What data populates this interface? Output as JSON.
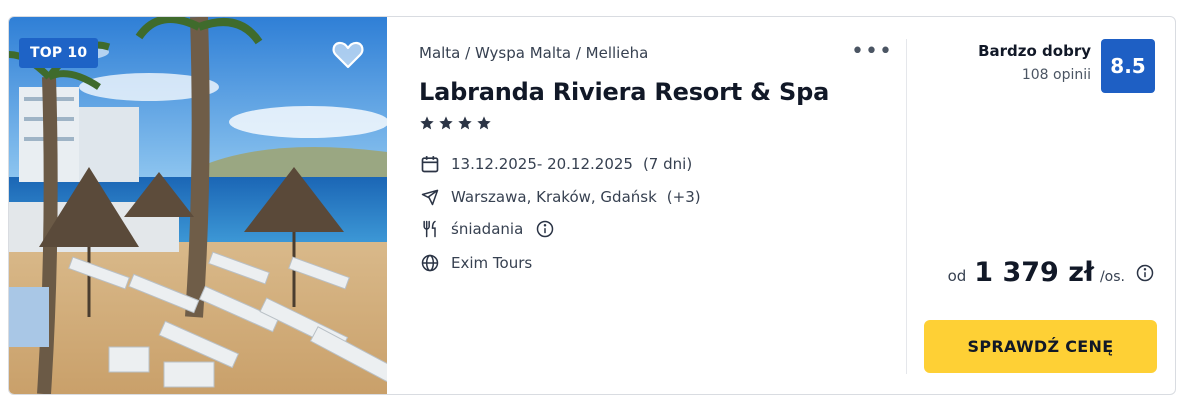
{
  "offer": {
    "badge": "TOP 10",
    "breadcrumb": "Malta / Wyspa Malta / Mellieha",
    "more_icon": "more-dots-icon",
    "title": "Labranda Riviera Resort & Spa",
    "stars": 4,
    "dates": "13.12.2025- 20.12.2025",
    "duration": "(7 dni)",
    "departures": "Warszawa, Kraków, Gdańsk",
    "departures_extra": "(+3)",
    "board": "śniadania",
    "operator": "Exim Tours"
  },
  "rating": {
    "label": "Bardzo dobry",
    "reviews": "108 opinii",
    "score": "8.5"
  },
  "price": {
    "prefix": "od",
    "amount": "1 379 zł",
    "suffix": "/os."
  },
  "cta": {
    "label": "SPRAWDŹ CENĘ"
  },
  "colors": {
    "badge": "#1e63c6",
    "score": "#1e5fc4",
    "cta": "#fed035",
    "text": "#111827"
  }
}
